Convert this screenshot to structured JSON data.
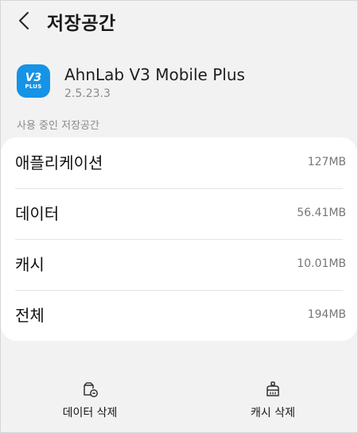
{
  "header": {
    "title": "저장공간"
  },
  "app": {
    "icon_text": "V3",
    "icon_subtext": "PLUS",
    "name": "AhnLab V3 Mobile Plus",
    "version": "2.5.23.3"
  },
  "storage": {
    "section_label": "사용 중인 저장공간",
    "rows": [
      {
        "label": "애플리케이션",
        "value": "127MB"
      },
      {
        "label": "데이터",
        "value": "56.41MB"
      },
      {
        "label": "캐시",
        "value": "10.01MB"
      },
      {
        "label": "전체",
        "value": "194MB"
      }
    ]
  },
  "actions": {
    "clear_data_label": "데이터 삭제",
    "clear_cache_label": "캐시 삭제"
  },
  "colors": {
    "background": "#f2f2f2",
    "card": "#ffffff",
    "app_icon": "#1593e6"
  }
}
